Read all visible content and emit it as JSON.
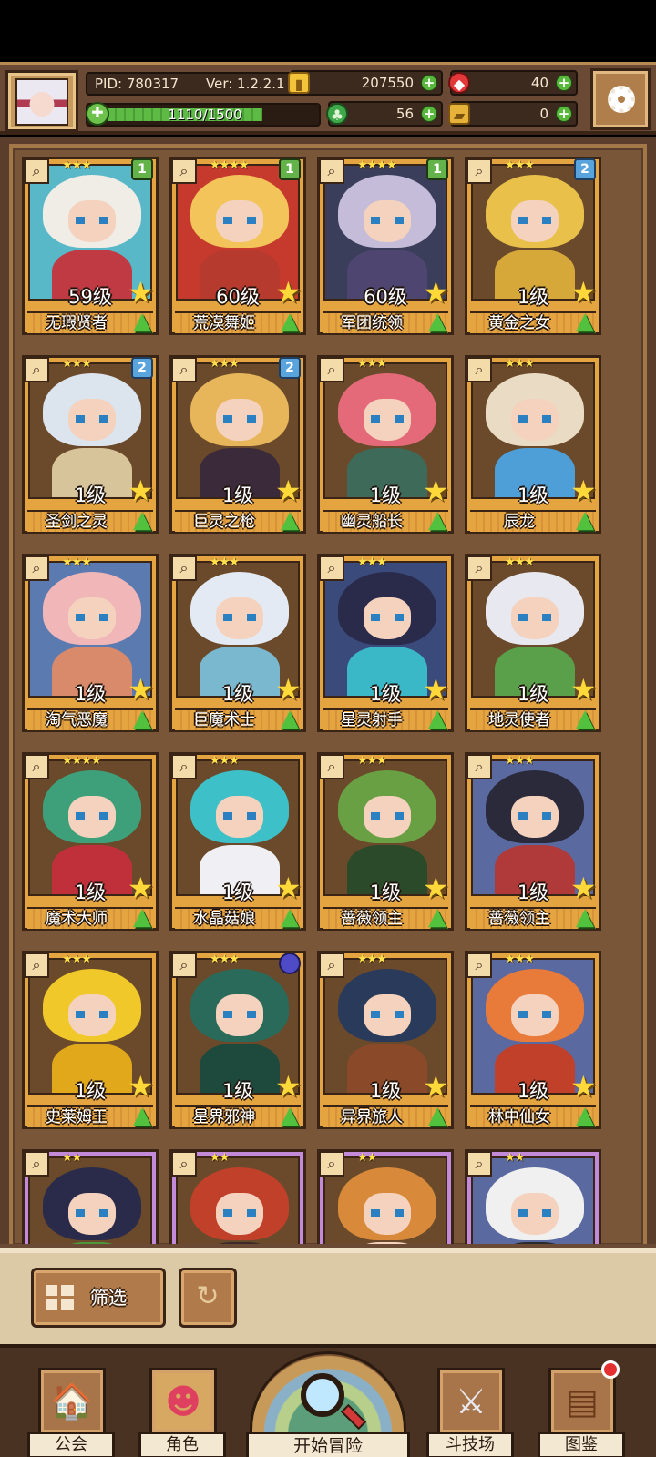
{
  "header": {
    "pid_label": "PID: 780317",
    "version": "Ver: 1.2.2.1",
    "exp": "1110/1500",
    "exp_fraction": 0.74,
    "resources": {
      "gold": "207550",
      "gems": "40",
      "clover": "56",
      "tickets": "0"
    },
    "icons": {
      "avatar": "player-portrait",
      "gold": "gold-coin-icon",
      "gems": "red-gem-icon",
      "clover": "clover-icon",
      "tickets": "ticket-icon",
      "settings": "gear-icon"
    }
  },
  "cards": [
    {
      "name": "无瑕贤者",
      "level": "59级",
      "stars": "★★★",
      "badge": "1",
      "badge_type": "green",
      "palette": [
        "#58b8c8",
        "#f0ece6",
        "#c03a44"
      ]
    },
    {
      "name": "荒漠舞姬",
      "level": "60级",
      "stars": "★★★★",
      "badge": "1",
      "badge_type": "green",
      "palette": [
        "#c63a2e",
        "#f2c45a",
        "#b63a2e"
      ]
    },
    {
      "name": "军团统领",
      "level": "60级",
      "stars": "★★★★",
      "badge": "1",
      "badge_type": "green",
      "palette": [
        "#3a3e5a",
        "#c4bcd8",
        "#4e4670"
      ]
    },
    {
      "name": "黄金之女",
      "level": "1级",
      "stars": "★★★",
      "badge": "2",
      "badge_type": "blue",
      "palette": [
        "#6a4a2a",
        "#e8c04a",
        "#d6a83a"
      ]
    },
    {
      "name": "圣剑之灵",
      "level": "1级",
      "stars": "★★★",
      "badge": "2",
      "badge_type": "blue",
      "palette": [
        "#6a4a2a",
        "#dce4ee",
        "#d8c49a"
      ]
    },
    {
      "name": "巨灵之枪",
      "level": "1级",
      "stars": "★★★",
      "badge": "2",
      "badge_type": "blue",
      "palette": [
        "#6a4a2a",
        "#e8b65a",
        "#3a2a3a"
      ]
    },
    {
      "name": "幽灵船长",
      "level": "1级",
      "stars": "★★★",
      "badge": "",
      "badge_type": "",
      "palette": [
        "#6a4a2a",
        "#e46a7a",
        "#3e6a5a"
      ]
    },
    {
      "name": "辰龙",
      "level": "1级",
      "stars": "★★★",
      "badge": "",
      "badge_type": "",
      "palette": [
        "#6a4a2a",
        "#eadcc4",
        "#4e9ed8"
      ]
    },
    {
      "name": "淘气恶魔",
      "level": "1级",
      "stars": "★★★",
      "badge": "",
      "badge_type": "",
      "palette": [
        "#5a7ab0",
        "#f0b6b8",
        "#d88a6a"
      ]
    },
    {
      "name": "巨魔术士",
      "level": "1级",
      "stars": "★★★",
      "badge": "",
      "badge_type": "",
      "palette": [
        "#6a4a2a",
        "#e4eaf4",
        "#7ab8d0"
      ]
    },
    {
      "name": "星灵射手",
      "level": "1级",
      "stars": "★★★",
      "badge": "",
      "badge_type": "",
      "palette": [
        "#3a4a7a",
        "#2a2a4a",
        "#3ab8c8"
      ]
    },
    {
      "name": "地灵使者",
      "level": "1级",
      "stars": "★★★",
      "badge": "",
      "badge_type": "",
      "palette": [
        "#6a4a2a",
        "#e8e8f0",
        "#5aa04a"
      ]
    },
    {
      "name": "魔术大师",
      "level": "1级",
      "stars": "★★★★",
      "badge": "",
      "badge_type": "",
      "palette": [
        "#6a4a2a",
        "#3ea07a",
        "#c0303a"
      ]
    },
    {
      "name": "水晶菇娘",
      "level": "1级",
      "stars": "★★★",
      "badge": "",
      "badge_type": "",
      "palette": [
        "#6a4a2a",
        "#3ec0c8",
        "#f0f0f4"
      ]
    },
    {
      "name": "蔷薇领主",
      "level": "1级",
      "stars": "★★★",
      "badge": "",
      "badge_type": "",
      "palette": [
        "#6a4a2a",
        "#6aa044",
        "#2a4a2a"
      ]
    },
    {
      "name": "蔷薇领主",
      "level": "1级",
      "stars": "★★★",
      "badge": "",
      "badge_type": "",
      "palette": [
        "#5a6aa0",
        "#2a2a3a",
        "#b03a3a"
      ]
    },
    {
      "name": "史莱姆王",
      "level": "1级",
      "stars": "★★★",
      "badge": "",
      "badge_type": "",
      "palette": [
        "#6a4a2a",
        "#f0c82a",
        "#e0a81a"
      ]
    },
    {
      "name": "星界邪神",
      "level": "1级",
      "stars": "★★★",
      "badge": "",
      "badge_type": "orb",
      "palette": [
        "#6a4a2a",
        "#2a6a5a",
        "#1e4a3e"
      ]
    },
    {
      "name": "异界旅人",
      "level": "1级",
      "stars": "★★★",
      "badge": "",
      "badge_type": "",
      "palette": [
        "#6a4a2a",
        "#2a3a5a",
        "#8a4a2a"
      ]
    },
    {
      "name": "林中仙女",
      "level": "1级",
      "stars": "★★★",
      "badge": "",
      "badge_type": "",
      "palette": [
        "#5a6aa0",
        "#e87a3a",
        "#c0402a"
      ]
    },
    {
      "name": "",
      "level": "",
      "stars": "★★",
      "badge": "",
      "badge_type": "",
      "purple": true,
      "palette": [
        "#6a4a2a",
        "#2a2a4a",
        "#4a9a3a"
      ]
    },
    {
      "name": "",
      "level": "",
      "stars": "★★",
      "badge": "",
      "badge_type": "",
      "purple": true,
      "palette": [
        "#6a4a2a",
        "#c0402a",
        "#3a2a2a"
      ]
    },
    {
      "name": "",
      "level": "",
      "stars": "★★",
      "badge": "",
      "badge_type": "",
      "purple": true,
      "palette": [
        "#6a4a2a",
        "#d88a3a",
        "#f4d2bd"
      ]
    },
    {
      "name": "",
      "level": "",
      "stars": "★★",
      "badge": "",
      "badge_type": "",
      "purple": true,
      "palette": [
        "#5a6aa0",
        "#f0f0f0",
        "#2a2a2a"
      ]
    }
  ],
  "filter": {
    "label": "筛选",
    "icons": {
      "filter": "grid-icon",
      "refresh": "refresh-icon"
    }
  },
  "nav": {
    "items": [
      {
        "label": "公会",
        "icon": "guild-house-icon"
      },
      {
        "label": "角色",
        "icon": "character-icon"
      },
      {
        "label": "开始冒险",
        "icon": "magnifier-map-icon"
      },
      {
        "label": "斗技场",
        "icon": "crossed-swords-icon"
      },
      {
        "label": "图鉴",
        "icon": "book-icon"
      }
    ]
  }
}
